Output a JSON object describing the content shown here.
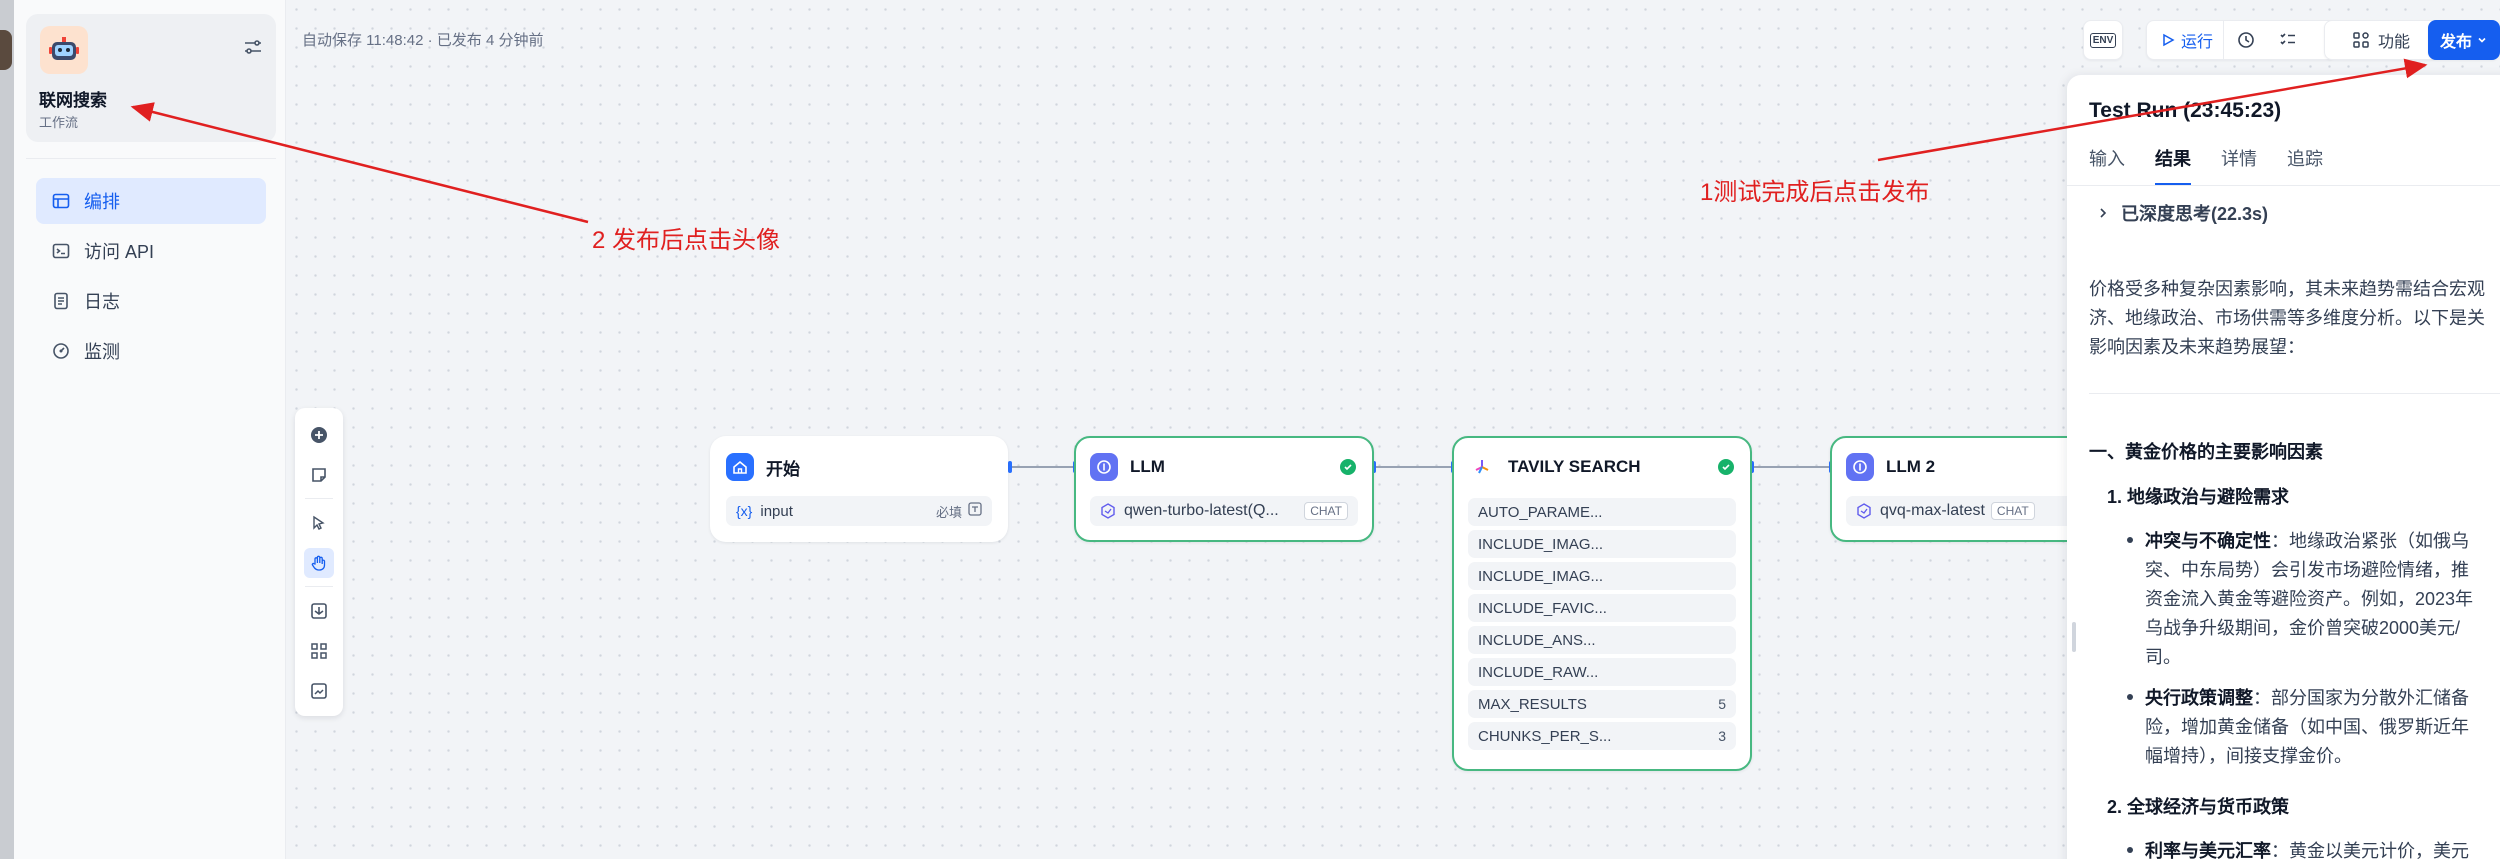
{
  "sidebar": {
    "app_name": "联网搜索",
    "app_type": "工作流",
    "nav": [
      {
        "label": "编排",
        "icon": "layout-icon",
        "active": true
      },
      {
        "label": "访问 API",
        "icon": "terminal-icon",
        "active": false
      },
      {
        "label": "日志",
        "icon": "log-icon",
        "active": false
      },
      {
        "label": "监测",
        "icon": "monitor-icon",
        "active": false
      }
    ]
  },
  "header": {
    "autosave": "自动保存 11:48:42 · 已发布 4 分钟前",
    "env_label": "ENV",
    "run_label": "运行",
    "features_label": "功能",
    "publish_label": "发布"
  },
  "nodes": {
    "start": {
      "title": "开始",
      "var_icon": "{x}",
      "var_name": "input",
      "required": "必填"
    },
    "llm1": {
      "title": "LLM",
      "model": "qwen-turbo-latest(Q...",
      "mode": "CHAT"
    },
    "tavily": {
      "title": "TAVILY SEARCH",
      "params": [
        {
          "label": "AUTO_PARAME...",
          "value": ""
        },
        {
          "label": "INCLUDE_IMAG...",
          "value": ""
        },
        {
          "label": "INCLUDE_IMAG...",
          "value": ""
        },
        {
          "label": "INCLUDE_FAVIC...",
          "value": ""
        },
        {
          "label": "INCLUDE_ANS...",
          "value": ""
        },
        {
          "label": "INCLUDE_RAW...",
          "value": ""
        },
        {
          "label": "MAX_RESULTS",
          "value": "5"
        },
        {
          "label": "CHUNKS_PER_S...",
          "value": "3"
        }
      ]
    },
    "llm2": {
      "title": "LLM 2",
      "model": "qvq-max-latest",
      "mode": "CHAT"
    }
  },
  "panel": {
    "title": "Test Run (23:45:23)",
    "tabs": [
      "输入",
      "结果",
      "详情",
      "追踪"
    ],
    "active_tab": "结果",
    "thinking": "已深度思考(22.3s)",
    "intro_lines": [
      "价格受多种复杂因素影响，其未来趋势需结合宏观",
      "济、地缘政治、市场供需等多维度分析。以下是关",
      "影响因素及未来趋势展望："
    ],
    "section1": "一、黄金价格的主要影响因素",
    "sub1": "1. 地缘政治与避险需求",
    "b1_bold": "冲突与不确定性",
    "b1_lines": [
      "：地缘政治紧张（如俄乌",
      "突、中东局势）会引发市场避险情绪，推",
      "资金流入黄金等避险资产。例如，2023年",
      "乌战争升级期间，金价曾突破2000美元/",
      "司。"
    ],
    "b2_bold": "央行政策调整",
    "b2_lines": [
      "：部分国家为分散外汇储备",
      "险，增加黄金储备（如中国、俄罗斯近年",
      "幅增持），间接支撑金价。"
    ],
    "sub2": "2. 全球经济与货币政策",
    "b3_bold": "利率与美元汇率",
    "b3_rest": "：黄金以美元计价，美元"
  },
  "annotations": {
    "a1": "2 发布后点击头像",
    "a2": "1测试完成后点击发布"
  },
  "colors": {
    "accent": "#155eef",
    "success": "#17b26a",
    "annotation": "#e02020"
  }
}
